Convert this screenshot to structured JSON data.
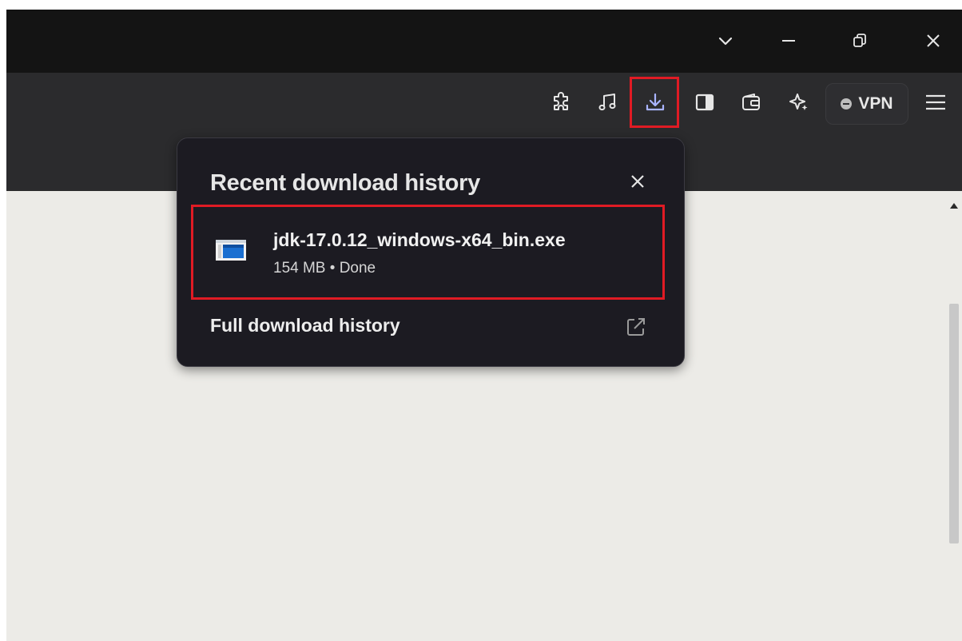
{
  "colors": {
    "titlebar": "#141414",
    "toolbar": "#2b2b2d",
    "popup_bg": "#1c1b22",
    "highlight": "#e01b24",
    "content_bg": "#ecebe7",
    "download_icon": "#a9b4ff"
  },
  "window_controls": {
    "icons": [
      "chevron-down-icon",
      "minimize-icon",
      "restore-icon",
      "close-icon"
    ]
  },
  "toolbar": {
    "icons": [
      "extensions-icon",
      "music-icon",
      "download-icon",
      "sidebar-icon",
      "wallet-icon",
      "aria-icon",
      "menu-icon"
    ],
    "vpn_label": "VPN"
  },
  "downloads_popup": {
    "title": "Recent download history",
    "items": [
      {
        "file_name": "jdk-17.0.12_windows-x64_bin.exe",
        "meta": "154 MB • Done",
        "icon": "exe-file-icon"
      }
    ],
    "full_history_label": "Full download history",
    "close_icon": "close-icon",
    "open_icon": "external-link-icon"
  }
}
